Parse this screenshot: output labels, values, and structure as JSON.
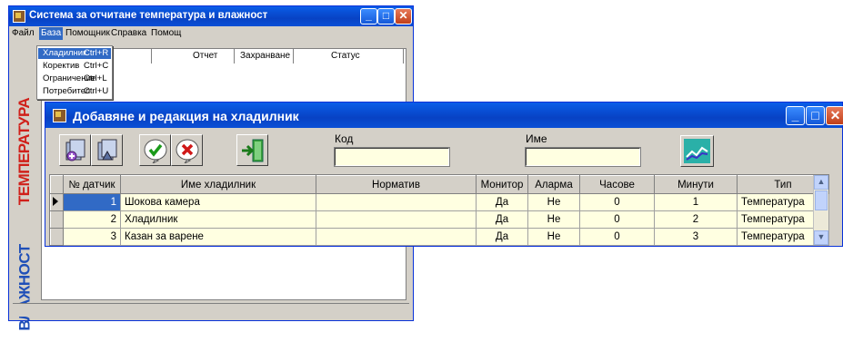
{
  "main_window": {
    "title": "Система за отчитане температура и влажност",
    "menu": [
      "Файл",
      "База",
      "Помощник",
      "Справка",
      "Помощ"
    ],
    "grid_headers": [
      "Отчет",
      "Захранване",
      "Статус"
    ],
    "side_labels": [
      "ТЕМПЕРАТУРА",
      "ВЛАЖНОСТ"
    ]
  },
  "dropdown": {
    "items": [
      {
        "label": "Хладилник",
        "shortcut": "Ctrl+R"
      },
      {
        "label": "Коректив",
        "shortcut": "Ctrl+C"
      },
      {
        "label": "Ограничение",
        "shortcut": "Ctrl+L"
      },
      {
        "label": "Потребител",
        "shortcut": "Ctrl+U"
      }
    ]
  },
  "dialog": {
    "title": "Добавяне и редакция на хладилник",
    "fields": {
      "code_label": "Код",
      "code_value": "",
      "name_label": "Име",
      "name_value": ""
    },
    "toolbar_icons": [
      "add-record-icon",
      "edit-record-icon",
      "confirm-icon",
      "cancel-icon",
      "exit-door-icon",
      "chart-icon"
    ],
    "table": {
      "headers": [
        "№ датчик",
        "Име хладилник",
        "Норматив",
        "Монитор",
        "Аларма",
        "Часове",
        "Минути",
        "Тип"
      ],
      "rows": [
        [
          "1",
          "Шокова камера",
          "",
          "Да",
          "Не",
          "0",
          "1",
          "Температура"
        ],
        [
          "2",
          "Хладилник",
          "",
          "Да",
          "Не",
          "0",
          "2",
          "Температура"
        ],
        [
          "3",
          "Казан за варене",
          "",
          "Да",
          "Не",
          "0",
          "3",
          "Температура"
        ]
      ]
    }
  },
  "colors": {
    "title_bar": "#0842c4",
    "grid_cell": "#ffffe1",
    "selection": "#316ac5",
    "side_label_red": "#d0201a",
    "side_label_blue": "#1f4fb8"
  }
}
